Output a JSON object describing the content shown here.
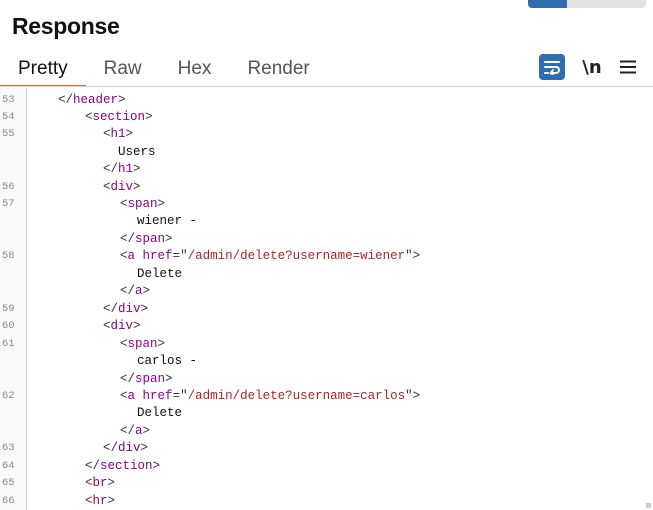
{
  "panel": {
    "title": "Response"
  },
  "tabs": [
    {
      "label": "Pretty",
      "active": true
    },
    {
      "label": "Raw",
      "active": false
    },
    {
      "label": "Hex",
      "active": false
    },
    {
      "label": "Render",
      "active": false
    }
  ],
  "toolbar": {
    "wrap_icon": "wrap-lines-icon",
    "newline_label": "\\n",
    "menu_icon": "hamburger-menu-icon",
    "accent_color": "#2f6db0"
  },
  "code_lines": [
    {
      "ln": "53",
      "tokens": [
        {
          "t": "</",
          "c": "punc"
        },
        {
          "t": "header",
          "c": "tag"
        },
        {
          "t": ">",
          "c": "punc"
        }
      ]
    },
    {
      "ln": "54",
      "tokens": [
        {
          "t": "<",
          "c": "punc"
        },
        {
          "t": "section",
          "c": "tag"
        },
        {
          "t": ">",
          "c": "punc"
        }
      ]
    },
    {
      "ln": "55",
      "tokens": [
        {
          "t": "<",
          "c": "punc"
        },
        {
          "t": "h1",
          "c": "tag"
        },
        {
          "t": ">",
          "c": "punc"
        }
      ]
    },
    {
      "ln": "",
      "tokens": [
        {
          "t": "Users",
          "c": "txt"
        }
      ]
    },
    {
      "ln": "",
      "tokens": [
        {
          "t": "</",
          "c": "punc"
        },
        {
          "t": "h1",
          "c": "tag"
        },
        {
          "t": ">",
          "c": "punc"
        }
      ]
    },
    {
      "ln": "56",
      "tokens": [
        {
          "t": "<",
          "c": "punc"
        },
        {
          "t": "div",
          "c": "tag"
        },
        {
          "t": ">",
          "c": "punc"
        }
      ]
    },
    {
      "ln": "57",
      "tokens": [
        {
          "t": "<",
          "c": "punc"
        },
        {
          "t": "span",
          "c": "tag"
        },
        {
          "t": ">",
          "c": "punc"
        }
      ]
    },
    {
      "ln": "",
      "tokens": [
        {
          "t": "wiener -",
          "c": "txt"
        }
      ]
    },
    {
      "ln": "",
      "tokens": [
        {
          "t": "</",
          "c": "punc"
        },
        {
          "t": "span",
          "c": "tag"
        },
        {
          "t": ">",
          "c": "punc"
        }
      ]
    },
    {
      "ln": "58",
      "tokens": [
        {
          "t": "<",
          "c": "punc"
        },
        {
          "t": "a",
          "c": "tag"
        },
        {
          "t": " ",
          "c": "punc"
        },
        {
          "t": "href",
          "c": "attr"
        },
        {
          "t": "=\"",
          "c": "punc"
        },
        {
          "t": "/admin/delete?username=wiener",
          "c": "str"
        },
        {
          "t": "\">",
          "c": "punc"
        }
      ]
    },
    {
      "ln": "",
      "tokens": [
        {
          "t": "Delete",
          "c": "txt"
        }
      ]
    },
    {
      "ln": "",
      "tokens": [
        {
          "t": "</",
          "c": "punc"
        },
        {
          "t": "a",
          "c": "tag"
        },
        {
          "t": ">",
          "c": "punc"
        }
      ]
    },
    {
      "ln": "59",
      "tokens": [
        {
          "t": "</",
          "c": "punc"
        },
        {
          "t": "div",
          "c": "tag"
        },
        {
          "t": ">",
          "c": "punc"
        }
      ]
    },
    {
      "ln": "60",
      "tokens": [
        {
          "t": "<",
          "c": "punc"
        },
        {
          "t": "div",
          "c": "tag"
        },
        {
          "t": ">",
          "c": "punc"
        }
      ]
    },
    {
      "ln": "61",
      "tokens": [
        {
          "t": "<",
          "c": "punc"
        },
        {
          "t": "span",
          "c": "tag"
        },
        {
          "t": ">",
          "c": "punc"
        }
      ]
    },
    {
      "ln": "",
      "tokens": [
        {
          "t": "carlos -",
          "c": "txt"
        }
      ]
    },
    {
      "ln": "",
      "tokens": [
        {
          "t": "</",
          "c": "punc"
        },
        {
          "t": "span",
          "c": "tag"
        },
        {
          "t": ">",
          "c": "punc"
        }
      ]
    },
    {
      "ln": "62",
      "tokens": [
        {
          "t": "<",
          "c": "punc"
        },
        {
          "t": "a",
          "c": "tag"
        },
        {
          "t": " ",
          "c": "punc"
        },
        {
          "t": "href",
          "c": "attr"
        },
        {
          "t": "=\"",
          "c": "punc"
        },
        {
          "t": "/admin/delete?username=carlos",
          "c": "str"
        },
        {
          "t": "\">",
          "c": "punc"
        }
      ]
    },
    {
      "ln": "",
      "tokens": [
        {
          "t": "Delete",
          "c": "txt"
        }
      ]
    },
    {
      "ln": "",
      "tokens": [
        {
          "t": "</",
          "c": "punc"
        },
        {
          "t": "a",
          "c": "tag"
        },
        {
          "t": ">",
          "c": "punc"
        }
      ]
    },
    {
      "ln": "63",
      "tokens": [
        {
          "t": "</",
          "c": "punc"
        },
        {
          "t": "div",
          "c": "tag"
        },
        {
          "t": ">",
          "c": "punc"
        }
      ]
    },
    {
      "ln": "64",
      "tokens": [
        {
          "t": "</",
          "c": "punc"
        },
        {
          "t": "section",
          "c": "tag"
        },
        {
          "t": ">",
          "c": "punc"
        }
      ]
    },
    {
      "ln": "65",
      "tokens": [
        {
          "t": "<",
          "c": "punc"
        },
        {
          "t": "br",
          "c": "tag"
        },
        {
          "t": ">",
          "c": "punc"
        }
      ]
    },
    {
      "ln": "66",
      "tokens": [
        {
          "t": "<",
          "c": "punc"
        },
        {
          "t": "hr",
          "c": "tag"
        },
        {
          "t": ">",
          "c": "punc"
        }
      ]
    }
  ]
}
